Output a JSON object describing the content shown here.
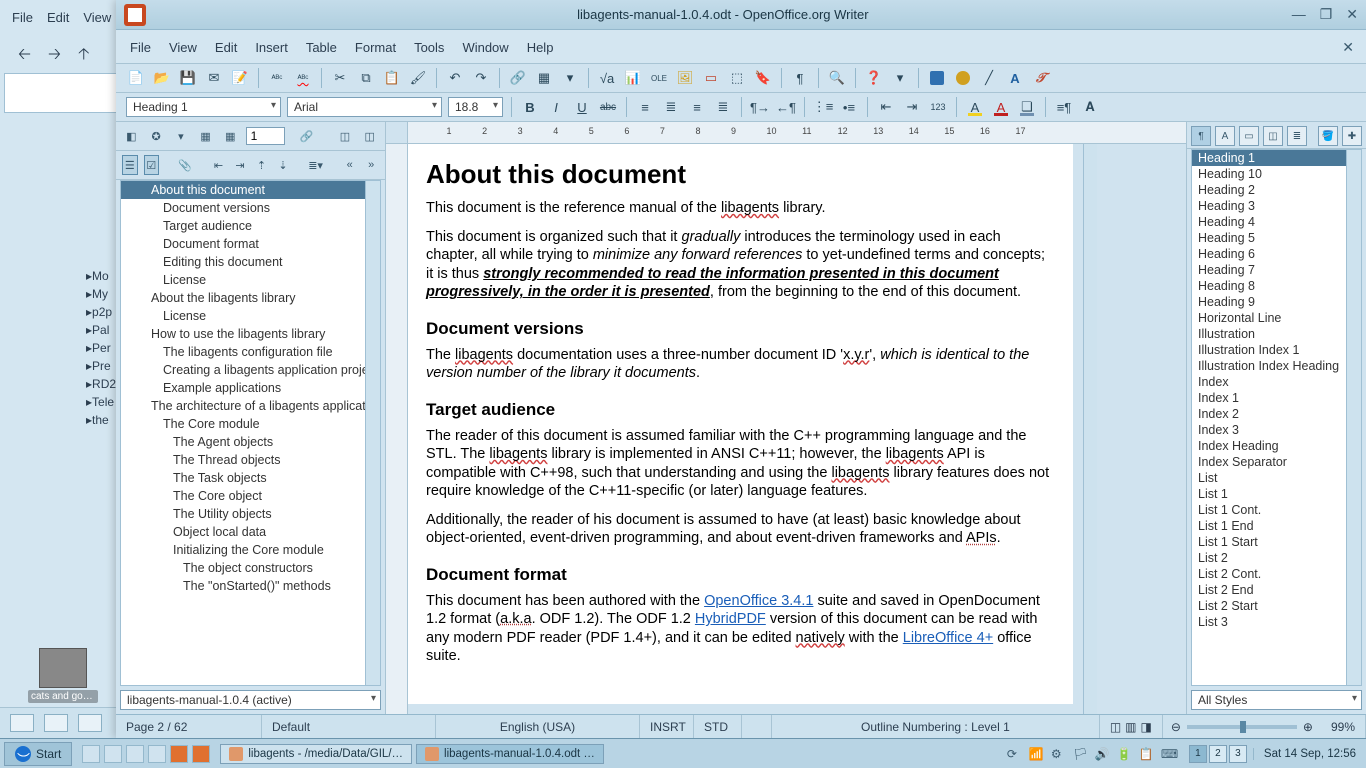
{
  "host_window": {
    "menu": [
      "File",
      "Edit",
      "View"
    ],
    "tree_items": [
      "Mo",
      "My",
      "p2p",
      "Pal",
      "Per",
      "Pre",
      "RD2",
      "Tele",
      "the"
    ]
  },
  "desktop_icon": {
    "label": "cats and gog…"
  },
  "writer": {
    "titlebar": {
      "title": "libagents-manual-1.0.4.odt - OpenOffice.org Writer"
    },
    "menubar": [
      "File",
      "View",
      "Edit",
      "Insert",
      "Table",
      "Format",
      "Tools",
      "Window",
      "Help"
    ],
    "formatbar": {
      "para_style": "Heading 1",
      "font_name": "Arial",
      "font_size": "18.8"
    },
    "navigator": {
      "page_spin": "1",
      "outline": [
        {
          "t": "About this document",
          "l": 1,
          "sel": true
        },
        {
          "t": "Document versions",
          "l": 2
        },
        {
          "t": "Target audience",
          "l": 2
        },
        {
          "t": "Document format",
          "l": 2
        },
        {
          "t": "Editing this document",
          "l": 2
        },
        {
          "t": "License",
          "l": 2
        },
        {
          "t": "About the libagents library",
          "l": 1
        },
        {
          "t": "License",
          "l": 2
        },
        {
          "t": "How to use the libagents library",
          "l": 1
        },
        {
          "t": "The libagents configuration file",
          "l": 2
        },
        {
          "t": "Creating a libagents application project",
          "l": 2
        },
        {
          "t": "Example applications",
          "l": 2
        },
        {
          "t": "The architecture of a libagents application",
          "l": 1
        },
        {
          "t": "The Core module",
          "l": 2
        },
        {
          "t": "The Agent objects",
          "l": 3
        },
        {
          "t": "The Thread objects",
          "l": 3
        },
        {
          "t": "The Task objects",
          "l": 3
        },
        {
          "t": "The Core object",
          "l": 3
        },
        {
          "t": "The Utility objects",
          "l": 3
        },
        {
          "t": "Object local data",
          "l": 3
        },
        {
          "t": "Initializing the Core module",
          "l": 3
        },
        {
          "t": "The object constructors",
          "l": 4
        },
        {
          "t": "The \"onStarted()\" methods",
          "l": 4
        }
      ],
      "doc_select": "libagents-manual-1.0.4 (active)"
    },
    "ruler_numbers": [
      1,
      2,
      3,
      4,
      5,
      6,
      7,
      8,
      9,
      10,
      11,
      12,
      13,
      14,
      15,
      16,
      17
    ],
    "document": {
      "h1": "About this document",
      "p1_a": "This document is the reference manual of the ",
      "p1_lib": "libagents",
      "p1_b": " library.",
      "p2_a": "This document is organized such that it ",
      "p2_grad": "gradually",
      "p2_b": " introduces the terminology used in each chapter, all while trying to ",
      "p2_min": "minimize any forward references",
      "p2_c": " to yet-undefined terms and concepts; it is thus ",
      "p2_strong": "strongly recommended to read the information presented in this document progressively, in the order it is presented",
      "p2_d": ", from the beginning to the end of this document.",
      "h2_1": "Document versions",
      "p3_a": "The ",
      "p3_lib": "libagents",
      "p3_b": " documentation uses a three-number document ID '",
      "p3_xyr": "x.y.r",
      "p3_c": "', ",
      "p3_it": "which is identical to the version number of the library it documents",
      "p3_d": ".",
      "h2_2": "Target audience",
      "p4_a": "The reader of this document is assumed familiar with the C++ programming language and the STL. The ",
      "p4_lib": "libagents",
      "p4_b": " library is implemented in ANSI C++11; however, the ",
      "p4_lib2": "libagents",
      "p4_c": " API is compatible with C++98, such that understanding and using the ",
      "p4_lib3": "libagents",
      "p4_d": " library features does not require knowledge of the C++11-specific (or later) language features.",
      "p5_a": "Additionally, the reader of his document is assumed to have (at least) basic knowledge about object-oriented, event-driven programming, and about event-driven frameworks and ",
      "p5_apis": "APIs",
      "p5_b": ".",
      "h2_3": "Document format",
      "p6_a": "This document has been authored with the ",
      "p6_oo": "OpenOffice 3.4.1",
      "p6_b": " suite and saved in OpenDocument 1.2 format (",
      "p6_aka": "a.k.a",
      "p6_c": ". ODF 1.2). The ODF 1.2 ",
      "p6_hpdf": "HybridPDF",
      "p6_d": " version of this document can be read with any modern PDF reader (PDF 1.4+), and it can be edited ",
      "p6_nat": "natively",
      "p6_e": " with the ",
      "p6_lo": "LibreOffice 4+",
      "p6_f": " office suite."
    },
    "styles": {
      "list": [
        "Heading 1",
        "Heading 10",
        "Heading 2",
        "Heading 3",
        "Heading 4",
        "Heading 5",
        "Heading 6",
        "Heading 7",
        "Heading 8",
        "Heading 9",
        "Horizontal Line",
        "Illustration",
        "Illustration Index 1",
        "Illustration Index Heading",
        "Index",
        "Index 1",
        "Index 2",
        "Index 3",
        "Index Heading",
        "Index Separator",
        "List",
        "List 1",
        "List 1 Cont.",
        "List 1 End",
        "List 1 Start",
        "List 2",
        "List 2 Cont.",
        "List 2 End",
        "List 2 Start",
        "List 3"
      ],
      "selected": 0,
      "filter": "All Styles"
    },
    "statusbar": {
      "page": "Page 2 / 62",
      "page_style": "Default",
      "language": "English (USA)",
      "insert": "INSRT",
      "selmode": "STD",
      "outline_msg": "Outline Numbering : Level 1",
      "zoom_pct": "99%"
    }
  },
  "taskbar": {
    "start": "Start",
    "tasks": [
      {
        "label": "libagents - /media/Data/GIL/…",
        "active": false
      },
      {
        "label": "libagents-manual-1.0.4.odt …",
        "active": true
      }
    ],
    "desktops": [
      "1",
      "2",
      "3"
    ],
    "active_desktop": 0,
    "clock": "Sat 14 Sep, 12:56"
  }
}
